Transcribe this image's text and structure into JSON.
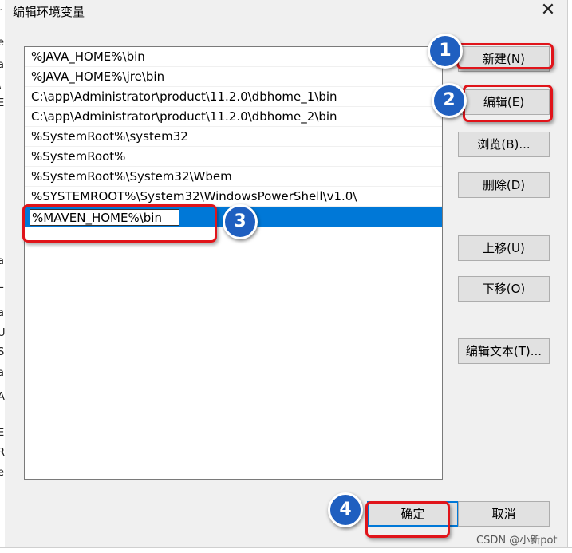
{
  "dialog": {
    "title": "编辑环境变量",
    "close_glyph": "✕"
  },
  "paths": [
    "%JAVA_HOME%\\bin",
    "%JAVA_HOME%\\jre\\bin",
    "C:\\app\\Administrator\\product\\11.2.0\\dbhome_1\\bin",
    "C:\\app\\Administrator\\product\\11.2.0\\dbhome_2\\bin",
    "%SystemRoot%\\system32",
    "%SystemRoot%",
    "%SystemRoot%\\System32\\Wbem",
    "%SYSTEMROOT%\\System32\\WindowsPowerShell\\v1.0\\"
  ],
  "editing_value": "%MAVEN_HOME%\\bin",
  "buttons": {
    "new": "新建(N)",
    "edit": "编辑(E)",
    "browse": "浏览(B)...",
    "delete": "删除(D)",
    "move_up": "上移(U)",
    "move_down": "下移(O)",
    "edit_text": "编辑文本(T)...",
    "ok": "确定",
    "cancel": "取消"
  },
  "badges": [
    "1",
    "2",
    "3",
    "4"
  ],
  "left_strip_chars": [
    "r",
    "e",
    "a",
    "\\",
    "E",
    "a",
    "L",
    "a",
    "U",
    "S",
    "a",
    "A",
    "E",
    "R",
    "e"
  ],
  "watermark": "CSDN @小新pot",
  "colors": {
    "selection": "#0078d7",
    "highlight": "#e0141a",
    "badge": "#1f5fc0"
  }
}
